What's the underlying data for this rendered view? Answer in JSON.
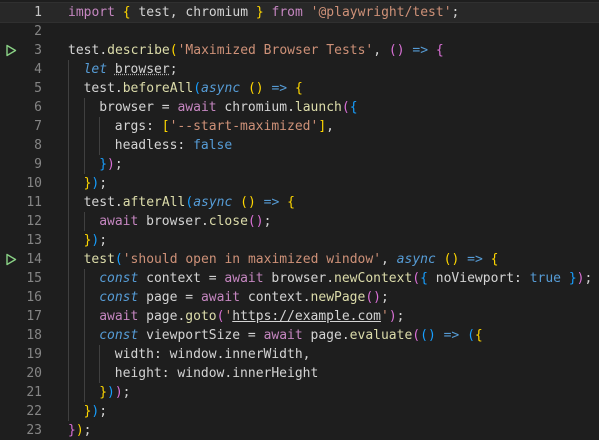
{
  "editor": {
    "current_line": 1,
    "run_lines": [
      3,
      14
    ],
    "lines": [
      {
        "n": "1",
        "indent": 0,
        "tokens": [
          [
            "import",
            "kw"
          ],
          [
            " ",
            "pun"
          ],
          [
            "{",
            "br1"
          ],
          [
            " test, chromium ",
            "pun"
          ],
          [
            "}",
            "br1"
          ],
          [
            " ",
            "pun"
          ],
          [
            "from",
            "kw"
          ],
          [
            " ",
            "pun"
          ],
          [
            "'@playwright/test'",
            "str"
          ],
          [
            ";",
            "pun"
          ]
        ]
      },
      {
        "n": "2",
        "indent": 0,
        "tokens": []
      },
      {
        "n": "3",
        "indent": 0,
        "tokens": [
          [
            "test",
            "pun"
          ],
          [
            ".",
            "pun"
          ],
          [
            "describe",
            "fn"
          ],
          [
            "(",
            "br1"
          ],
          [
            "'Maximized Browser Tests'",
            "str"
          ],
          [
            ", ",
            "pun"
          ],
          [
            "()",
            "br2"
          ],
          [
            " ",
            "pun"
          ],
          [
            "=>",
            "st"
          ],
          [
            " ",
            "pun"
          ],
          [
            "{",
            "br2"
          ]
        ]
      },
      {
        "n": "4",
        "indent": 1,
        "tokens": [
          [
            "let",
            "st"
          ],
          [
            " ",
            "pun"
          ],
          [
            "browser",
            "warn"
          ],
          [
            ";",
            "pun"
          ]
        ]
      },
      {
        "n": "5",
        "indent": 1,
        "tokens": [
          [
            "test",
            "pun"
          ],
          [
            ".",
            "pun"
          ],
          [
            "beforeAll",
            "fn"
          ],
          [
            "(",
            "br3"
          ],
          [
            "async",
            "st"
          ],
          [
            " ",
            "pun"
          ],
          [
            "()",
            "br1"
          ],
          [
            " ",
            "pun"
          ],
          [
            "=>",
            "st"
          ],
          [
            " ",
            "pun"
          ],
          [
            "{",
            "br1"
          ]
        ]
      },
      {
        "n": "6",
        "indent": 2,
        "tokens": [
          [
            "browser",
            "pun"
          ],
          [
            " = ",
            "pun"
          ],
          [
            "await",
            "kw"
          ],
          [
            " chromium",
            "pun"
          ],
          [
            ".",
            "pun"
          ],
          [
            "launch",
            "fn"
          ],
          [
            "(",
            "br2"
          ],
          [
            "{",
            "br3"
          ]
        ]
      },
      {
        "n": "7",
        "indent": 3,
        "tokens": [
          [
            "args",
            "pun"
          ],
          [
            ": ",
            "pun"
          ],
          [
            "[",
            "br1"
          ],
          [
            "'--start-maximized'",
            "str"
          ],
          [
            "]",
            "br1"
          ],
          [
            ",",
            "pun"
          ]
        ]
      },
      {
        "n": "8",
        "indent": 3,
        "tokens": [
          [
            "headless",
            "pun"
          ],
          [
            ": ",
            "pun"
          ],
          [
            "false",
            "lit"
          ]
        ]
      },
      {
        "n": "9",
        "indent": 2,
        "tokens": [
          [
            "}",
            "br3"
          ],
          [
            ")",
            "br2"
          ],
          [
            ";",
            "pun"
          ]
        ]
      },
      {
        "n": "10",
        "indent": 1,
        "tokens": [
          [
            "}",
            "br1"
          ],
          [
            ")",
            "br3"
          ],
          [
            ";",
            "pun"
          ]
        ]
      },
      {
        "n": "11",
        "indent": 1,
        "tokens": [
          [
            "test",
            "pun"
          ],
          [
            ".",
            "pun"
          ],
          [
            "afterAll",
            "fn"
          ],
          [
            "(",
            "br3"
          ],
          [
            "async",
            "st"
          ],
          [
            " ",
            "pun"
          ],
          [
            "()",
            "br1"
          ],
          [
            " ",
            "pun"
          ],
          [
            "=>",
            "st"
          ],
          [
            " ",
            "pun"
          ],
          [
            "{",
            "br1"
          ]
        ]
      },
      {
        "n": "12",
        "indent": 2,
        "tokens": [
          [
            "await",
            "kw"
          ],
          [
            " browser",
            "pun"
          ],
          [
            ".",
            "pun"
          ],
          [
            "close",
            "fn"
          ],
          [
            "()",
            "br2"
          ],
          [
            ";",
            "pun"
          ]
        ]
      },
      {
        "n": "13",
        "indent": 1,
        "tokens": [
          [
            "}",
            "br1"
          ],
          [
            ")",
            "br3"
          ],
          [
            ";",
            "pun"
          ]
        ]
      },
      {
        "n": "14",
        "indent": 1,
        "tokens": [
          [
            "test",
            "fn"
          ],
          [
            "(",
            "br3"
          ],
          [
            "'should open in maximized window'",
            "str"
          ],
          [
            ", ",
            "pun"
          ],
          [
            "async",
            "st"
          ],
          [
            " ",
            "pun"
          ],
          [
            "()",
            "br1"
          ],
          [
            " ",
            "pun"
          ],
          [
            "=>",
            "st"
          ],
          [
            " ",
            "pun"
          ],
          [
            "{",
            "br1"
          ]
        ]
      },
      {
        "n": "15",
        "indent": 2,
        "tokens": [
          [
            "const",
            "st"
          ],
          [
            " context = ",
            "pun"
          ],
          [
            "await",
            "kw"
          ],
          [
            " browser",
            "pun"
          ],
          [
            ".",
            "pun"
          ],
          [
            "newContext",
            "fn"
          ],
          [
            "(",
            "br2"
          ],
          [
            "{",
            "br3"
          ],
          [
            " noViewport: ",
            "pun"
          ],
          [
            "true",
            "lit"
          ],
          [
            " ",
            "pun"
          ],
          [
            "}",
            "br3"
          ],
          [
            ")",
            "br2"
          ],
          [
            ";",
            "pun"
          ]
        ]
      },
      {
        "n": "16",
        "indent": 2,
        "tokens": [
          [
            "const",
            "st"
          ],
          [
            " page = ",
            "pun"
          ],
          [
            "await",
            "kw"
          ],
          [
            " context",
            "pun"
          ],
          [
            ".",
            "pun"
          ],
          [
            "newPage",
            "fn"
          ],
          [
            "()",
            "br2"
          ],
          [
            ";",
            "pun"
          ]
        ]
      },
      {
        "n": "17",
        "indent": 2,
        "tokens": [
          [
            "await",
            "kw"
          ],
          [
            " page",
            "pun"
          ],
          [
            ".",
            "pun"
          ],
          [
            "goto",
            "fn"
          ],
          [
            "(",
            "br2"
          ],
          [
            "'",
            "str"
          ],
          [
            "https://example.com",
            "link"
          ],
          [
            "'",
            "str"
          ],
          [
            ")",
            "br2"
          ],
          [
            ";",
            "pun"
          ]
        ]
      },
      {
        "n": "18",
        "indent": 2,
        "tokens": [
          [
            "const",
            "st"
          ],
          [
            " viewportSize = ",
            "pun"
          ],
          [
            "await",
            "kw"
          ],
          [
            " page",
            "pun"
          ],
          [
            ".",
            "pun"
          ],
          [
            "evaluate",
            "fn"
          ],
          [
            "(",
            "br2"
          ],
          [
            "()",
            "br3"
          ],
          [
            " ",
            "pun"
          ],
          [
            "=>",
            "st"
          ],
          [
            " ",
            "pun"
          ],
          [
            "(",
            "br3"
          ],
          [
            "{",
            "br1"
          ]
        ]
      },
      {
        "n": "19",
        "indent": 3,
        "tokens": [
          [
            "width",
            "pun"
          ],
          [
            ": ",
            "pun"
          ],
          [
            "window",
            "pun"
          ],
          [
            ".",
            "pun"
          ],
          [
            "innerWidth",
            "pun"
          ],
          [
            ",",
            "pun"
          ]
        ]
      },
      {
        "n": "20",
        "indent": 3,
        "tokens": [
          [
            "height",
            "pun"
          ],
          [
            ": ",
            "pun"
          ],
          [
            "window",
            "pun"
          ],
          [
            ".",
            "pun"
          ],
          [
            "innerHeight",
            "pun"
          ]
        ]
      },
      {
        "n": "21",
        "indent": 2,
        "tokens": [
          [
            "}",
            "br1"
          ],
          [
            ")",
            "br3"
          ],
          [
            ")",
            "br2"
          ],
          [
            ";",
            "pun"
          ]
        ]
      },
      {
        "n": "22",
        "indent": 1,
        "tokens": [
          [
            "}",
            "br1"
          ],
          [
            ")",
            "br3"
          ],
          [
            ";",
            "pun"
          ]
        ]
      },
      {
        "n": "23",
        "indent": 0,
        "tokens": [
          [
            "}",
            "br2"
          ],
          [
            ")",
            "br1"
          ],
          [
            ";",
            "pun"
          ]
        ]
      }
    ]
  },
  "colors": {
    "background": "#1e1e1e",
    "current_line": "#282828",
    "keyword_control": "#c586c0",
    "keyword_storage": "#569cd6",
    "function": "#dcdcaa",
    "string": "#ce9178",
    "run_icon": "#89d185"
  },
  "icons": {
    "run": "run-test-icon"
  }
}
